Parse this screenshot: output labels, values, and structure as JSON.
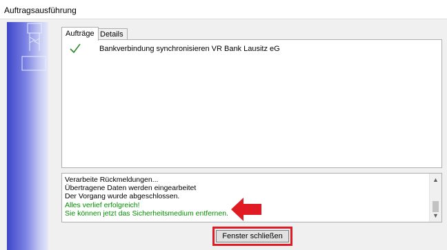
{
  "window": {
    "title": "Auftragsausführung"
  },
  "tabs": [
    {
      "label": "Aufträge",
      "active": true
    },
    {
      "label": "Details",
      "active": false
    }
  ],
  "tasks": [
    {
      "status": "checkmark-icon",
      "label": "Bankverbindung synchronisieren VR Bank Lausitz eG"
    }
  ],
  "log": {
    "lines": [
      {
        "text": "Verarbeite Rückmeldungen...",
        "color": "#000000"
      },
      {
        "text": "Übertragene Daten werden eingearbeitet",
        "color": "#000000"
      },
      {
        "text": "Der Vorgang wurde abgeschlossen.",
        "color": "#000000"
      },
      {
        "text": "Alles verlief erfolgreich!",
        "color": "#008f00"
      },
      {
        "text": "Sie können jetzt das Sicherheitsmedium entfernen.",
        "color": "#008f00"
      }
    ]
  },
  "footer": {
    "close_label": "Fenster schließen"
  },
  "colors": {
    "highlight": "#e01b24",
    "success_text": "#008f00",
    "check": "#2a8a2a"
  }
}
